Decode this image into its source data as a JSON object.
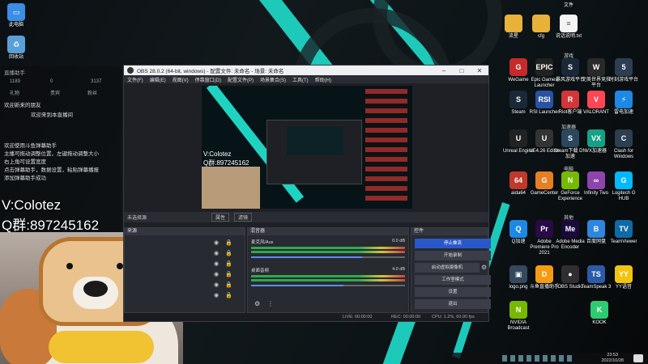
{
  "desktop": {
    "left_icons": [
      {
        "label": "此电脑",
        "icon": "computer-icon",
        "color": "#3a8ee6"
      },
      {
        "label": "回收站",
        "icon": "recycle-bin-icon",
        "color": "#5aa0d8"
      }
    ],
    "top_right": [
      {
        "label": "流星",
        "icon": "folder-icon",
        "color": "#e8b23a"
      },
      {
        "label": "cfg",
        "icon": "folder-icon",
        "color": "#e8b23a"
      },
      {
        "label": "文件",
        "icon": "folder-icon",
        "color": "#e8b23a"
      },
      {
        "label": "说话说明.txt",
        "icon": "text-file-icon",
        "color": "#ffffff"
      }
    ],
    "groups": [
      {
        "title": "游戏",
        "icons": [
          {
            "label": "WeGame",
            "glyph": "G",
            "color": "#c62a2a"
          },
          {
            "label": "Epic Games Launcher",
            "glyph": "EPIC",
            "color": "#222222"
          },
          {
            "label": "暴风游戏平台",
            "glyph": "S",
            "color": "#1b2838"
          },
          {
            "label": "完美世界竞技平台",
            "glyph": "W",
            "color": "#2a2a2a"
          },
          {
            "label": "时刻游戏平台",
            "glyph": "5",
            "color": "#2c3e50"
          }
        ]
      },
      {
        "title": "",
        "icons": [
          {
            "label": "Steam",
            "glyph": "S",
            "color": "#1b2838"
          },
          {
            "label": "RSI Launcher",
            "glyph": "RSI",
            "color": "#2952a3"
          },
          {
            "label": "Riot客户端",
            "glyph": "R",
            "color": "#d13639"
          },
          {
            "label": "VALORANT",
            "glyph": "V",
            "color": "#ff4655"
          },
          {
            "label": "雷电加速",
            "glyph": "⚡",
            "color": "#1e88e5"
          }
        ]
      },
      {
        "title": "加速器",
        "icons": [
          {
            "label": "Unreal Engine",
            "glyph": "U",
            "color": "#222222"
          },
          {
            "label": "UE4.26 Editor",
            "glyph": "U",
            "color": "#333333"
          },
          {
            "label": "Steam下载 DN加速",
            "glyph": "S",
            "color": "#2a475e"
          },
          {
            "label": "VX加速器",
            "glyph": "VX",
            "color": "#16a085"
          },
          {
            "label": "Clash for Windows",
            "glyph": "C",
            "color": "#2c3e50"
          }
        ]
      },
      {
        "title": "电脑",
        "icons": [
          {
            "label": "aida64",
            "glyph": "64",
            "color": "#c0392b"
          },
          {
            "label": "GameCenter",
            "glyph": "G",
            "color": "#e67e22"
          },
          {
            "label": "GeForce Experience",
            "glyph": "N",
            "color": "#76b900"
          },
          {
            "label": "Infinity Two",
            "glyph": "∞",
            "color": "#8e44ad"
          },
          {
            "label": "Logitech G HUB",
            "glyph": "G",
            "color": "#00b8fc"
          }
        ]
      },
      {
        "title": "其他",
        "icons": [
          {
            "label": "Q加速",
            "glyph": "Q",
            "color": "#1e88e5"
          },
          {
            "label": "Adobe Premiere Pro 2021",
            "glyph": "Pr",
            "color": "#2a0a45"
          },
          {
            "label": "Adobe Media Encoder",
            "glyph": "Me",
            "color": "#1a0a3a"
          },
          {
            "label": "百度网盘",
            "glyph": "B",
            "color": "#2e86de"
          },
          {
            "label": "TeamViewer",
            "glyph": "TV",
            "color": "#0e6ba8"
          }
        ]
      },
      {
        "title": "",
        "icons": [
          {
            "label": "logo.png",
            "glyph": "▣",
            "color": "#34495e"
          },
          {
            "label": "斗鱼直播助手",
            "glyph": "D",
            "color": "#f39c12"
          },
          {
            "label": "OBS Studio",
            "glyph": "●",
            "color": "#302e31"
          },
          {
            "label": "TeamSpeak 3",
            "glyph": "TS",
            "color": "#2b5ba8"
          },
          {
            "label": "YY语音",
            "glyph": "YY",
            "color": "#f1c40f"
          }
        ]
      },
      {
        "title": "",
        "icons": [
          {
            "label": "NVIDIA Broadcast",
            "glyph": "N",
            "color": "#76b900"
          },
          {
            "label": "KOOK",
            "glyph": "K",
            "color": "#2ecc71"
          }
        ]
      }
    ]
  },
  "chat": {
    "header": "直播助手",
    "stats": [
      "1189",
      "0",
      "3137"
    ],
    "tabs": [
      "礼物",
      "贵宾",
      "粉丝"
    ],
    "lines": [
      "欢迎新来的朋友",
      "欢迎来到本直播间",
      "",
      "欢迎使用斗鱼弹幕助手",
      "主播可拖动调整位置，左键拖动调整大小",
      "右上角可设置宽度",
      "点击弹幕助手，数据设置，粘贴弹幕播报",
      "添加弹幕助手成功"
    ],
    "promo": [
      "V:Colotez",
      "Q群:897245162"
    ]
  },
  "obs": {
    "title": "OBS 28.0.2 (64-bit, windows) - 配置文件: 未命名 - 场景: 未命名",
    "menu": [
      "文件(F)",
      "编辑(E)",
      "视图(V)",
      "停靠窗口(D)",
      "配置文件(P)",
      "场景集合(S)",
      "工具(T)",
      "帮助(H)"
    ],
    "scene_bar": {
      "label": "未选择源",
      "props_btn": "属性",
      "filters_btn": "滤镜"
    },
    "sources_title": "来源",
    "mixer": {
      "title": "混音器",
      "channels": [
        {
          "name": "麦克风/Aux",
          "db": "0.0 dB",
          "level": 0.72
        },
        {
          "name": "桌面音频",
          "db": "4.0 dB",
          "level": 0.6
        }
      ]
    },
    "controls": {
      "title": "控件",
      "buttons": [
        "停止推流",
        "开始录制",
        "启动虚拟摄像机",
        "工作室模式",
        "设置",
        "退出"
      ]
    },
    "status": {
      "live": "LIVE: 00:00:00",
      "rec": "REC: 00:00:00",
      "cpu": "CPU: 1.2%, 60.00 fps"
    }
  },
  "taskbar": {
    "time": "23:53",
    "date": "2022/10/28"
  }
}
